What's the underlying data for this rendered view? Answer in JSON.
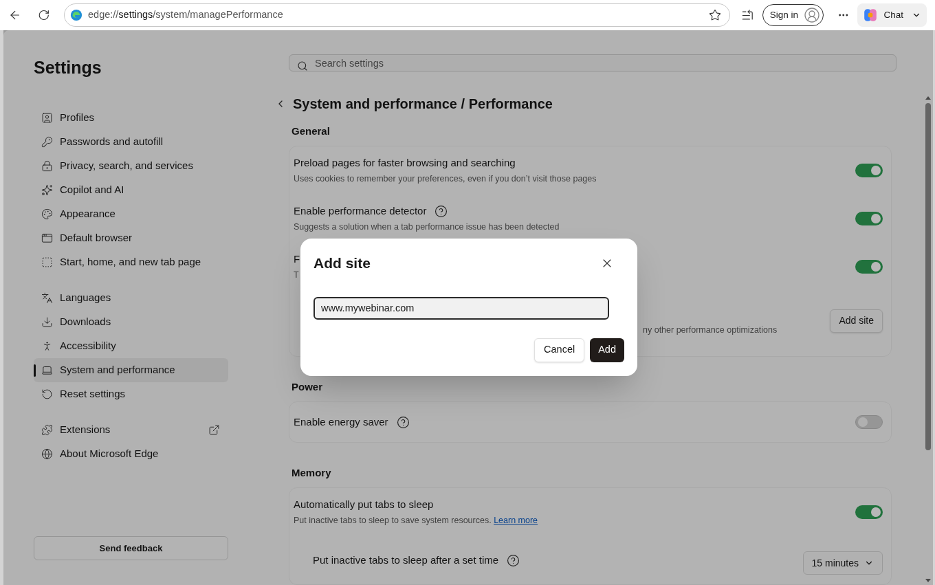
{
  "browser": {
    "scheme": "edge://",
    "host": "settings",
    "path": "/system/managePerformance",
    "sign_in": "Sign in",
    "chat": "Chat"
  },
  "sidebar": {
    "title": "Settings",
    "groups": [
      [
        {
          "label": "Profiles",
          "selected": false
        },
        {
          "label": "Passwords and autofill",
          "selected": false
        },
        {
          "label": "Privacy, search, and services",
          "selected": false
        },
        {
          "label": "Copilot and AI",
          "selected": false
        },
        {
          "label": "Appearance",
          "selected": false
        },
        {
          "label": "Default browser",
          "selected": false
        },
        {
          "label": "Start, home, and new tab page",
          "selected": false
        }
      ],
      [
        {
          "label": "Languages",
          "selected": false
        },
        {
          "label": "Downloads",
          "selected": false
        },
        {
          "label": "Accessibility",
          "selected": false
        },
        {
          "label": "System and performance",
          "selected": true
        },
        {
          "label": "Reset settings",
          "selected": false
        }
      ],
      [
        {
          "label": "Extensions",
          "selected": false,
          "external": true
        },
        {
          "label": "About Microsoft Edge",
          "selected": false
        }
      ]
    ],
    "feedback": "Send feedback"
  },
  "search": {
    "placeholder": "Search settings"
  },
  "breadcrumb": {
    "parent": "System and performance",
    "separator": "/",
    "current": "Performance"
  },
  "sections": [
    {
      "title": "General",
      "rows": [
        {
          "kind": "toggle",
          "title": "Preload pages for faster browsing and searching",
          "description": "Uses cookies to remember your preferences, even if you don’t visit those pages",
          "on": true
        },
        {
          "kind": "toggle",
          "title": "Enable performance detector",
          "help": true,
          "description": "Suggests a solution when a tab performance issue has been detected",
          "on": true
        },
        {
          "kind": "toggle",
          "title": "F",
          "description": "T",
          "on": true
        },
        {
          "kind": "button",
          "description": "ny other performance optimizations",
          "button": "Add site"
        }
      ]
    },
    {
      "title": "Power",
      "rows": [
        {
          "kind": "toggle",
          "title": "Enable energy saver",
          "help": true,
          "on": false
        }
      ]
    },
    {
      "title": "Memory",
      "rows": [
        {
          "kind": "toggle",
          "title": "Automatically put tabs to sleep",
          "description": "Put inactive tabs to sleep to save system resources.",
          "link": "Learn more",
          "on": true
        },
        {
          "kind": "select",
          "title": "Put inactive tabs to sleep after a set time",
          "help": true,
          "value": "15 minutes"
        }
      ]
    }
  ],
  "dialog": {
    "title": "Add site",
    "value": "www.mywebinar.com",
    "cancel": "Cancel",
    "confirm": "Add"
  }
}
